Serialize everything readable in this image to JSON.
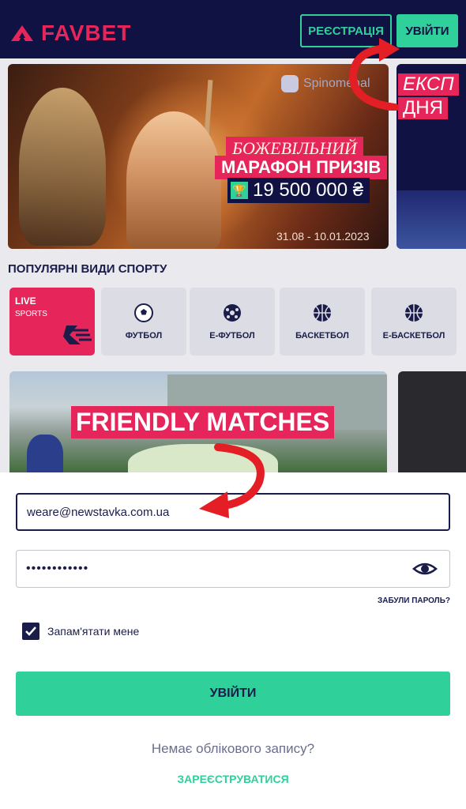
{
  "header": {
    "logo_text": "FAVBET",
    "register_label": "РЕЄСТРАЦІЯ",
    "login_label": "УВІЙТИ"
  },
  "banner": {
    "provider": "Spinomenal",
    "promo_line1": "БОЖЕВІЛЬНИЙ",
    "promo_line2": "МАРАФОН ПРИЗІВ",
    "promo_amount": "19 500 000 ₴",
    "promo_dates": "31.08 - 10.01.2023",
    "side_line1": "ЕКСП",
    "side_line2": "ДНЯ"
  },
  "sports": {
    "title": "ПОПУЛЯРНІ ВИДИ СПОРТУ",
    "live_label": "LIVE",
    "live_sub": "SPORTS",
    "items": [
      {
        "label": "ФУТБОЛ",
        "icon": "football-icon"
      },
      {
        "label": "Е-ФУТБОЛ",
        "icon": "efootball-icon"
      },
      {
        "label": "БАСКЕТБОЛ",
        "icon": "basketball-icon"
      },
      {
        "label": "Е-БАСКЕТБОЛ",
        "icon": "ebasketball-icon"
      }
    ]
  },
  "featured": {
    "title": "FRIENDLY MATCHES"
  },
  "login_form": {
    "email_value": "weare@newstavka.com.ua",
    "password_value": "••••••••••••",
    "forgot_label": "ЗАБУЛИ ПАРОЛЬ?",
    "remember_label": "Запам'ятати мене",
    "remember_checked": true,
    "submit_label": "УВІЙТИ",
    "no_account_text": "Немає облікового запису?",
    "register_link": "ЗАРЕЄСТРУВАТИСЯ"
  },
  "colors": {
    "navy": "#0f1242",
    "accent_green": "#2fd09a",
    "brand_pink": "#e6265a",
    "arrow_red": "#e31e24"
  }
}
